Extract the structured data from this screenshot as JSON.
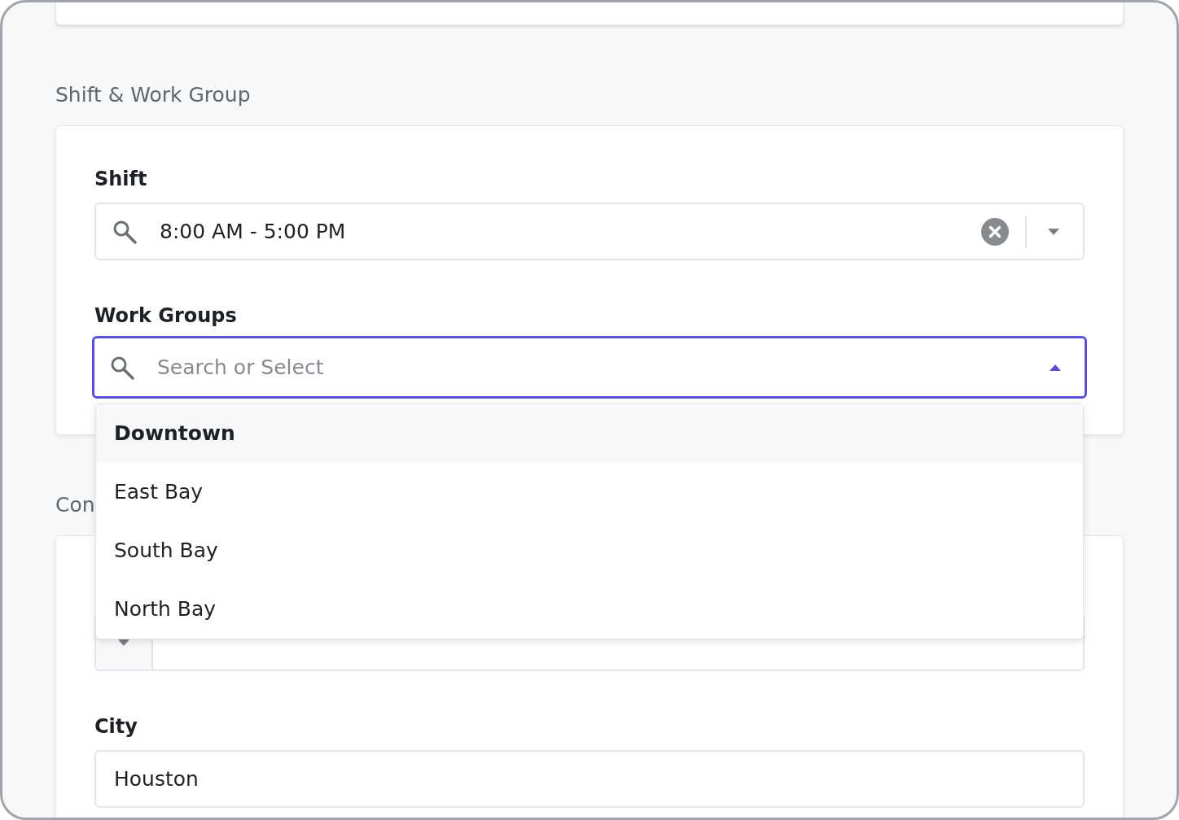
{
  "sections": [
    {
      "title": "Shift & Work Group",
      "fields": [
        {
          "kind": "select",
          "label": "Shift",
          "value": "8:00 AM - 5:00 PM",
          "clearable": true,
          "focused": false,
          "expanded": false
        },
        {
          "kind": "select",
          "label": "Work Groups",
          "placeholder": "Search or Select",
          "clearable": false,
          "focused": true,
          "expanded": true,
          "options": [
            {
              "label": "Downtown",
              "selected": true
            },
            {
              "label": "East Bay",
              "selected": false
            },
            {
              "label": "South Bay",
              "selected": false
            },
            {
              "label": "North Bay",
              "selected": false
            }
          ]
        }
      ]
    },
    {
      "title": "Con",
      "fields": [
        {
          "kind": "phone"
        },
        {
          "kind": "text",
          "label": "City",
          "value": "Houston"
        }
      ]
    }
  ]
}
